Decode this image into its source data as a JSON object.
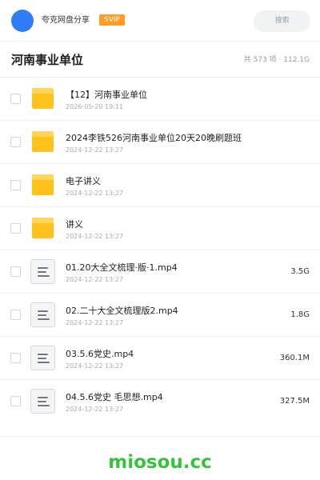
{
  "header": {
    "user_name": "夸克网盘分享",
    "badge": "SVIP",
    "search_placeholder": "搜索",
    "avatar_color": "#2f7cf6",
    "badge_color": "#ff9c23"
  },
  "folder": {
    "title": "河南事业单位",
    "summary": "共 573 项 · 112.1G"
  },
  "files": [
    {
      "type": "folder-icon",
      "name": "【12】河南事业单位",
      "date": "2026-05-20 19:11",
      "size": ""
    },
    {
      "type": "folder-icon",
      "name": "2024李铁526河南事业单位20天20晚刷题班",
      "date": "2024-12-22 13:27",
      "size": ""
    },
    {
      "type": "folder-icon",
      "name": "电子讲义",
      "date": "2024-12-22 13:27",
      "size": ""
    },
    {
      "type": "folder-icon",
      "name": "讲义",
      "date": "2024-12-22 13:27",
      "size": ""
    },
    {
      "type": "document-icon",
      "name": "01.20大全文梳理·版·1.mp4",
      "date": "2024-12-22 13:27",
      "size": "3.5G"
    },
    {
      "type": "document-icon",
      "name": "02.二十大全文梳理版2.mp4",
      "date": "2024-12-22 13:27",
      "size": "1.8G"
    },
    {
      "type": "document-icon",
      "name": "03.5.6党史.mp4",
      "date": "2024-12-22 13:27",
      "size": "360.1M"
    },
    {
      "type": "document-icon",
      "name": "04.5.6党史 毛思想.mp4",
      "date": "2024-12-22 13:27",
      "size": "327.5M"
    }
  ],
  "watermark": "miosou.cc",
  "colors": {
    "folder": "#ffc21d",
    "watermark": "#36c23e"
  }
}
